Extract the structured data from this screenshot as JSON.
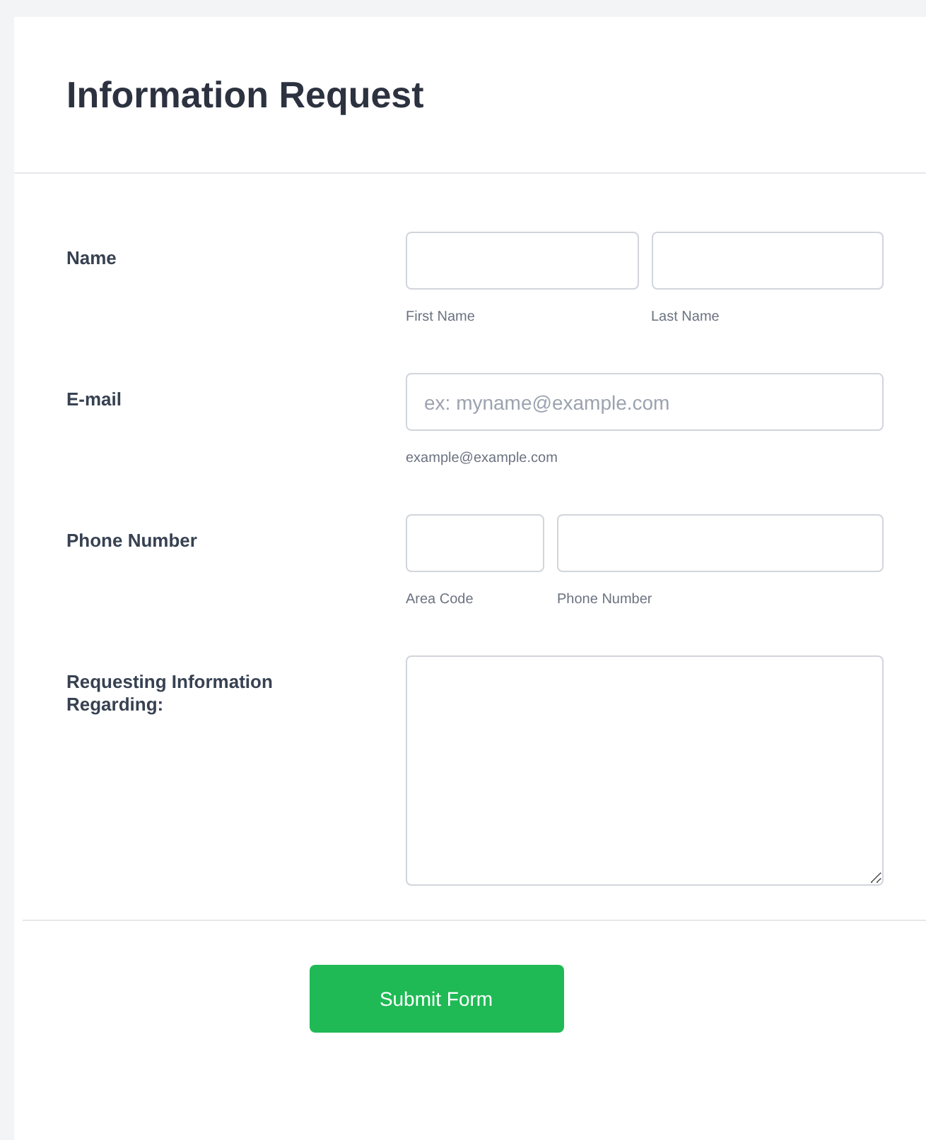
{
  "form": {
    "title": "Information Request",
    "fields": [
      {
        "kind": "name",
        "label": "Name",
        "inputs": [
          {
            "sublabel": "First Name"
          },
          {
            "sublabel": "Last Name"
          }
        ]
      },
      {
        "kind": "email",
        "label": "E-mail",
        "inputs": [
          {
            "placeholder": "ex: myname@example.com",
            "sublabel": "example@example.com"
          }
        ]
      },
      {
        "kind": "phone",
        "label": "Phone Number",
        "inputs": [
          {
            "sublabel": "Area Code"
          },
          {
            "sublabel": "Phone Number"
          }
        ]
      },
      {
        "kind": "textarea",
        "label": "Requesting Information Regarding:"
      }
    ],
    "submit": "Submit Form"
  }
}
